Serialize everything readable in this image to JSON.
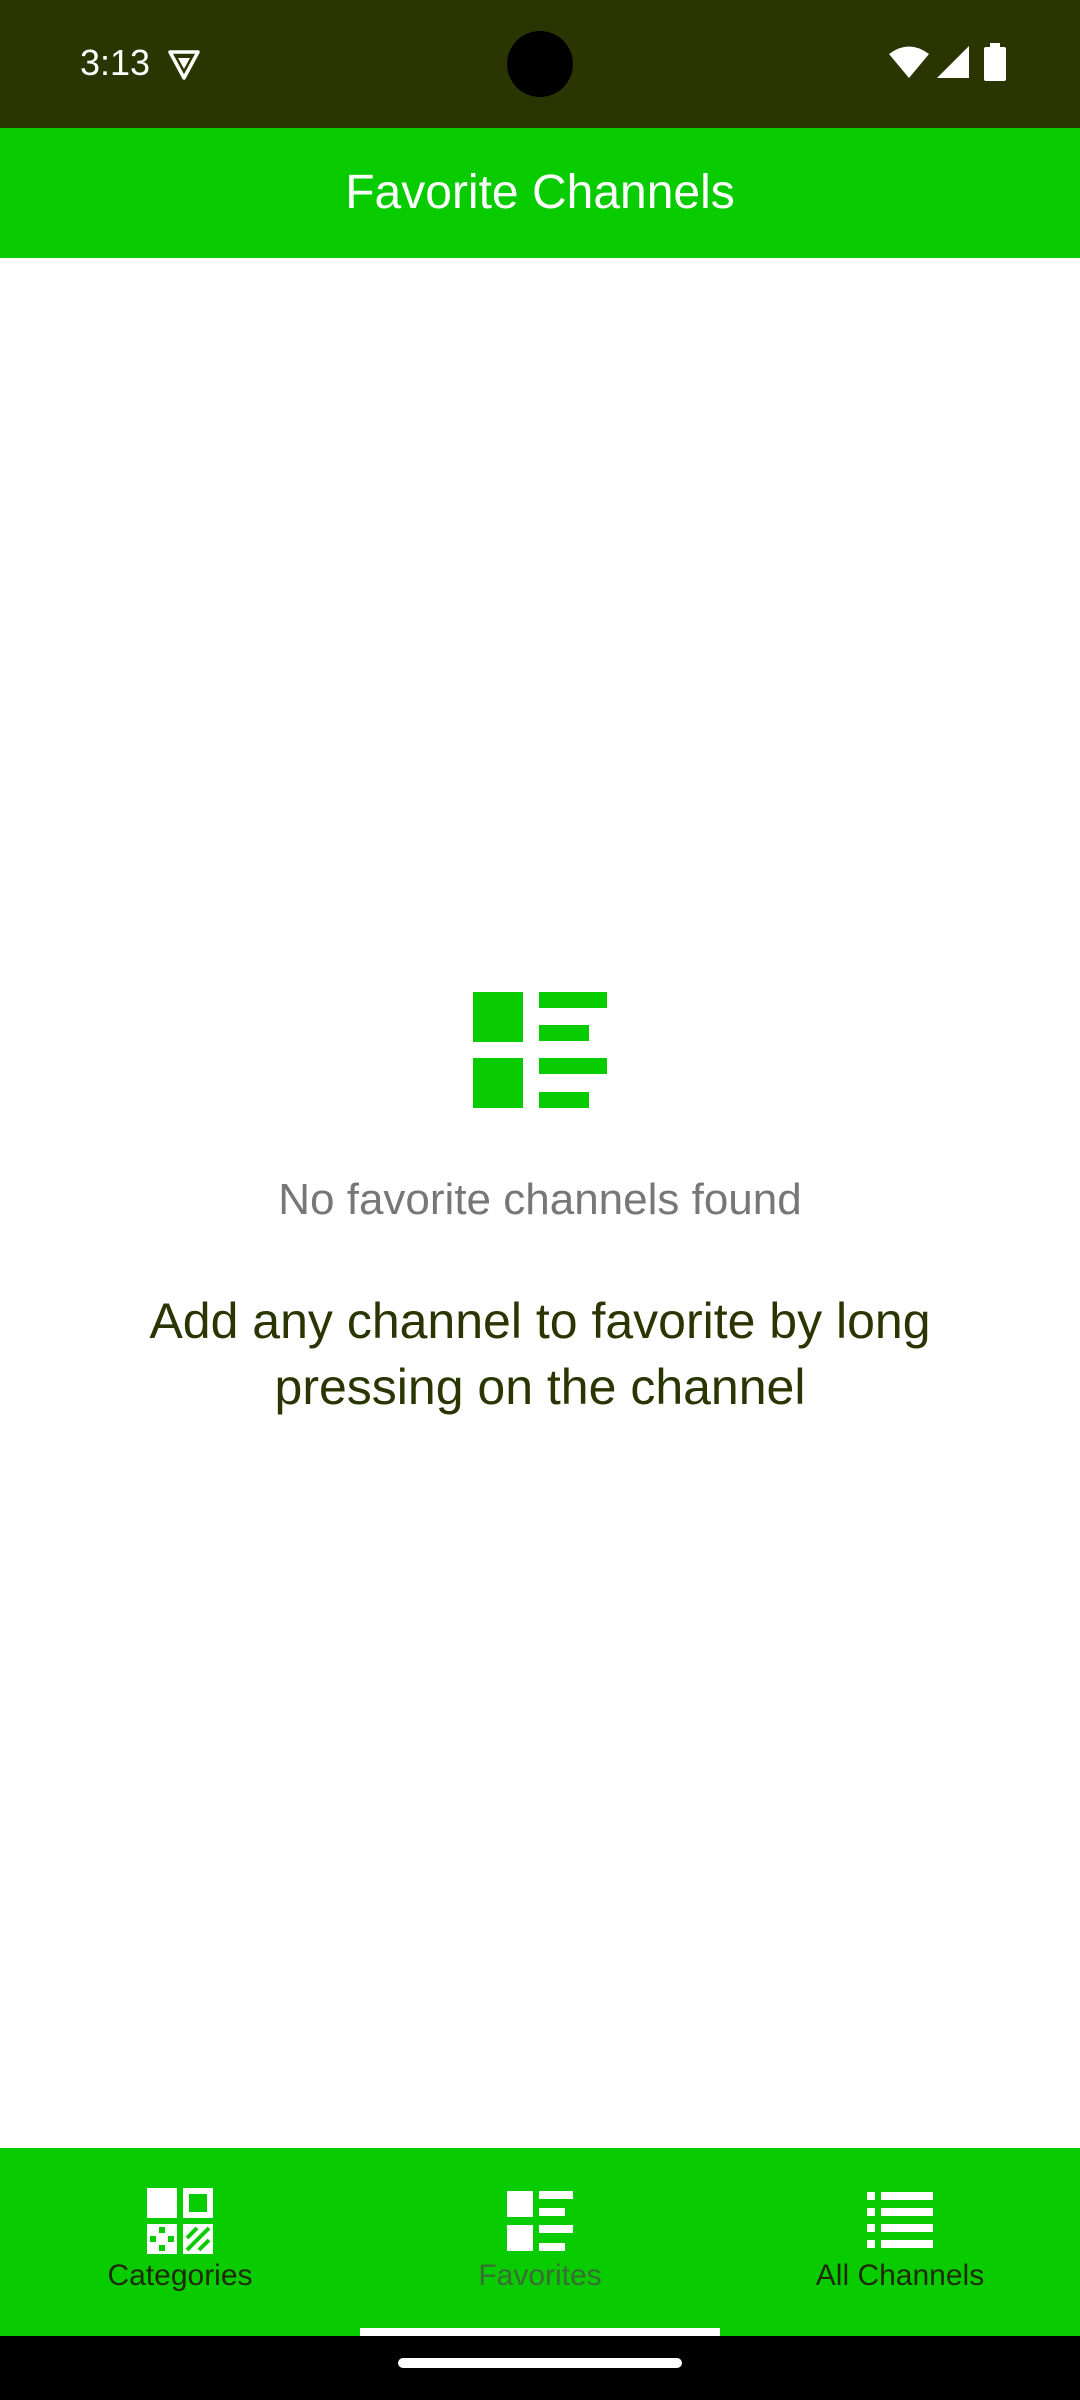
{
  "status_bar": {
    "time": "3:13",
    "icons": [
      "vpn-key-icon",
      "wifi-icon",
      "signal-icon",
      "battery-icon"
    ]
  },
  "app_bar": {
    "title": "Favorite Channels"
  },
  "empty_state": {
    "icon": "favorites-list-icon",
    "title": "No favorite channels found",
    "hint": "Add any channel to favorite by long pressing on the channel"
  },
  "bottom_nav": {
    "items": [
      {
        "label": "Categories",
        "icon": "categories-grid-icon",
        "active": false
      },
      {
        "label": "Favorites",
        "icon": "favorites-list-icon",
        "active": true
      },
      {
        "label": "All Channels",
        "icon": "list-icon",
        "active": false
      }
    ]
  },
  "colors": {
    "primary": "#08cc00",
    "status_bar": "#2b3502",
    "hint_text": "#2b3502",
    "muted_text": "#777777"
  }
}
